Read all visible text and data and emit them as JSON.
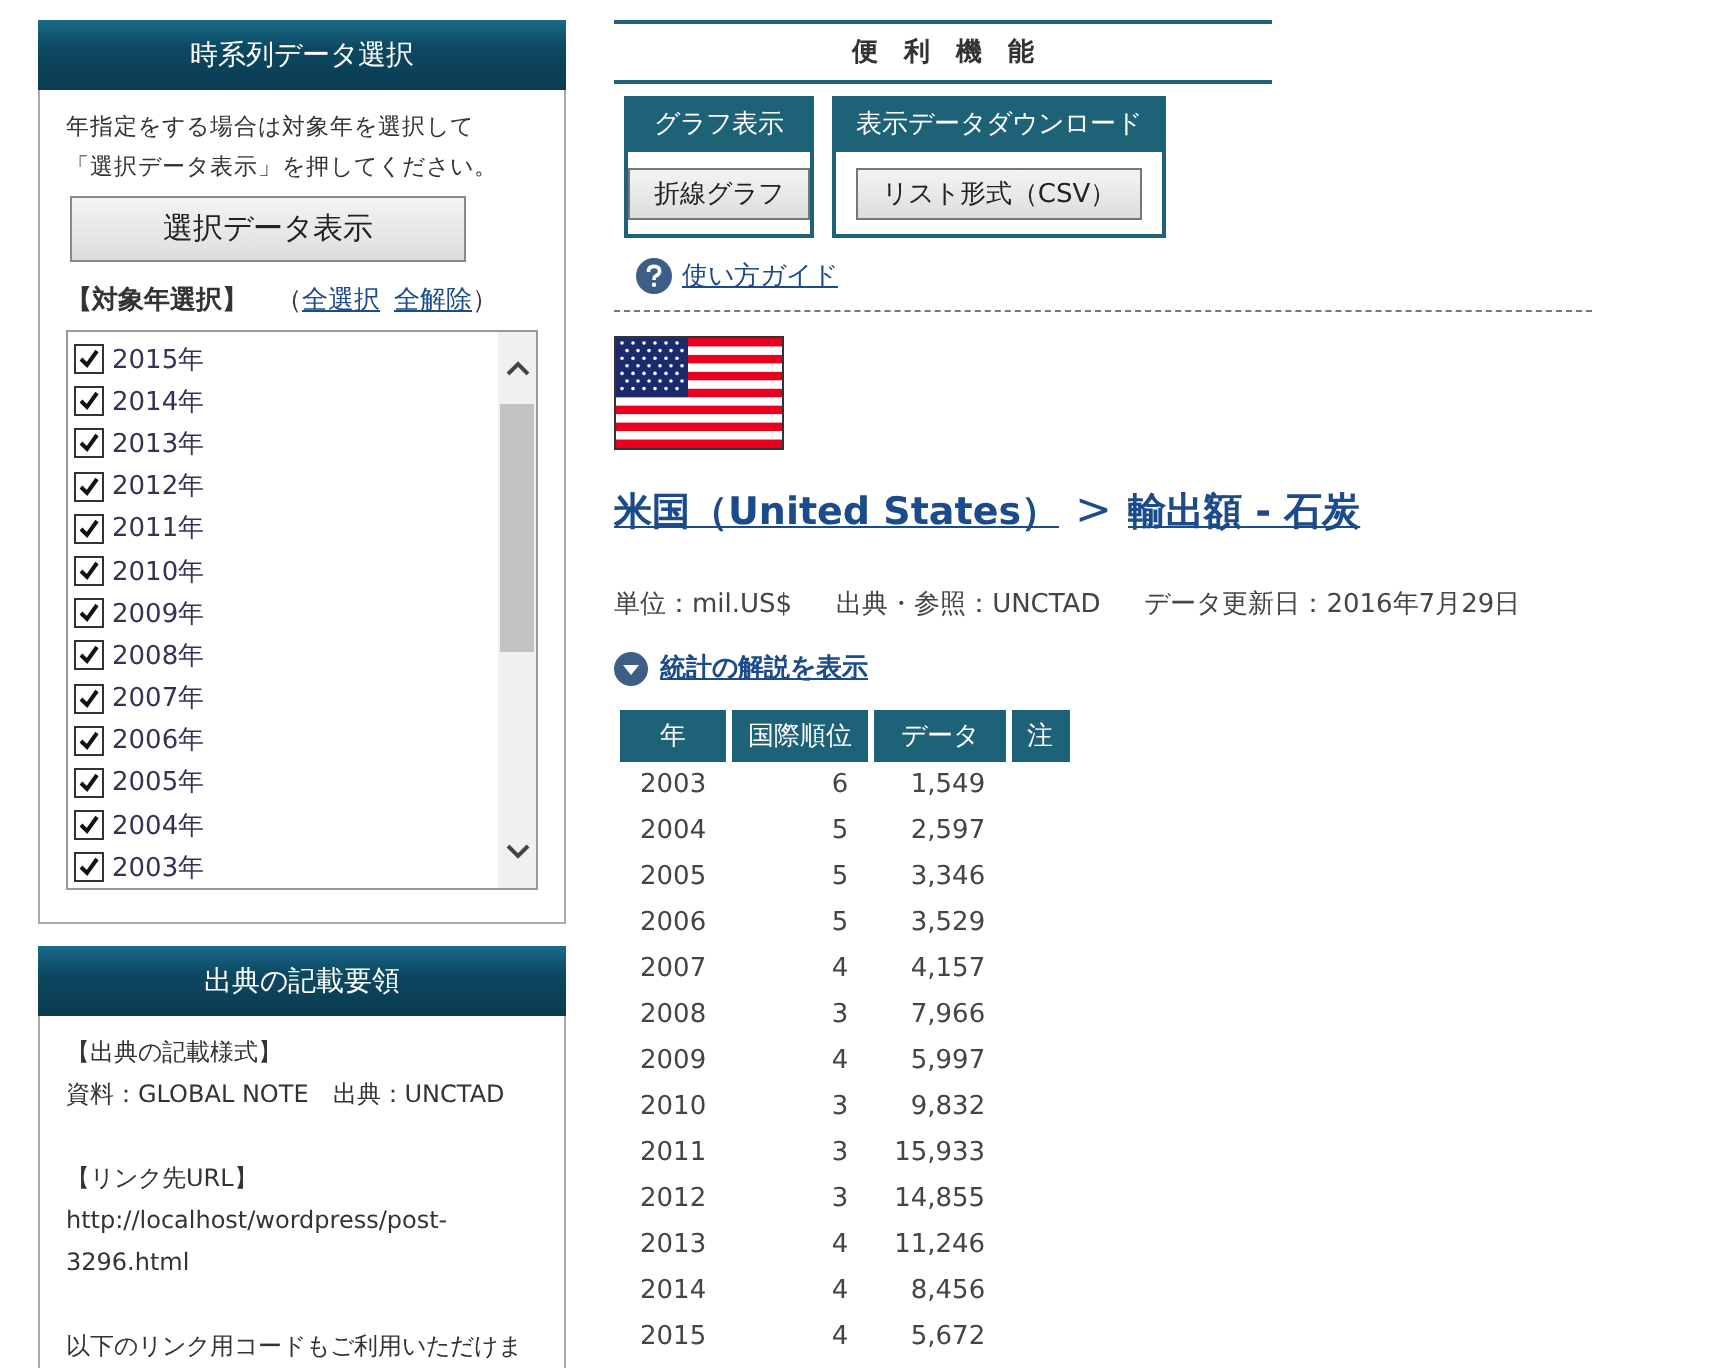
{
  "year_panel": {
    "title": "時系列データ選択",
    "intro": [
      "年指定をする場合は対象年を選択して",
      "「選択データ表示」を押してください。"
    ],
    "button": "選択データ表示",
    "select_label": "【対象年選択】",
    "open_paren": "（",
    "select_all": "全選択",
    "clear_all": "全解除",
    "close_paren": "）",
    "years": [
      {
        "label": "2015年",
        "checked": true
      },
      {
        "label": "2014年",
        "checked": true
      },
      {
        "label": "2013年",
        "checked": true
      },
      {
        "label": "2012年",
        "checked": true
      },
      {
        "label": "2011年",
        "checked": true
      },
      {
        "label": "2010年",
        "checked": true
      },
      {
        "label": "2009年",
        "checked": true
      },
      {
        "label": "2008年",
        "checked": true
      },
      {
        "label": "2007年",
        "checked": true
      },
      {
        "label": "2006年",
        "checked": true
      },
      {
        "label": "2005年",
        "checked": true
      },
      {
        "label": "2004年",
        "checked": true
      },
      {
        "label": "2003年",
        "checked": true
      }
    ]
  },
  "citation_panel": {
    "title": "出典の記載要領",
    "format_heading": "【出典の記載様式】",
    "format_text": "資料：GLOBAL NOTE　出典：UNCTAD",
    "url_heading": "【リンク先URL】",
    "url": "http://localhost/wordpress/post-3296.html",
    "code_note": "以下のリンク用コードもご利用いただけま"
  },
  "tools": {
    "title": "便　利　機　能",
    "groups": [
      {
        "title": "グラフ表示",
        "button": "折線グラフ"
      },
      {
        "title": "表示データダウンロード",
        "button": "リスト形式（CSV）"
      }
    ],
    "guide_link": "使い方ガイド"
  },
  "breadcrumb": {
    "country": "米国（United States）",
    "separator": ">",
    "topic": "輸出額 - 石炭"
  },
  "meta": {
    "unit": "単位：mil.US$",
    "source": "出典・参照：UNCTAD",
    "updated": "データ更新日：2016年7月29日"
  },
  "explain_link": "統計の解説を表示",
  "table": {
    "columns": [
      "年",
      "国際順位",
      "データ",
      "注"
    ],
    "rows": [
      [
        "2003",
        "6",
        "1,549"
      ],
      [
        "2004",
        "5",
        "2,597"
      ],
      [
        "2005",
        "5",
        "3,346"
      ],
      [
        "2006",
        "5",
        "3,529"
      ],
      [
        "2007",
        "4",
        "4,157"
      ],
      [
        "2008",
        "3",
        "7,966"
      ],
      [
        "2009",
        "4",
        "5,997"
      ],
      [
        "2010",
        "3",
        "9,832"
      ],
      [
        "2011",
        "3",
        "15,933"
      ],
      [
        "2012",
        "3",
        "14,855"
      ],
      [
        "2013",
        "4",
        "11,246"
      ],
      [
        "2014",
        "4",
        "8,456"
      ],
      [
        "2015",
        "4",
        "5,672"
      ]
    ]
  }
}
